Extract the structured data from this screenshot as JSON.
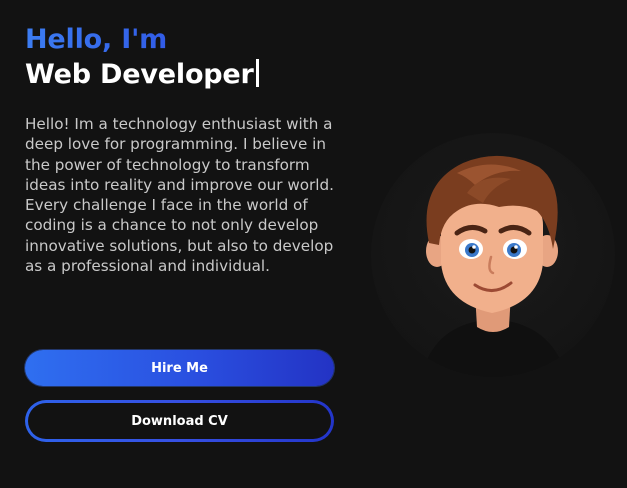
{
  "hero": {
    "greeting": "Hello, I'm",
    "role": "Web Developer",
    "bio": "Hello! Im a technology enthusiast with a deep love for programming. I believe in the power of technology to transform ideas into reality and improve our world. Every challenge I face in the world of coding is a chance to not only develop innovative solutions, but also to develop as a professional and individual."
  },
  "buttons": {
    "hire_label": "Hire Me",
    "cv_label": "Download CV"
  },
  "colors": {
    "accent_start": "#3c7df2",
    "accent_end": "#1f2cb8",
    "background": "#121212"
  },
  "icons": {
    "avatar": "cartoon-developer-avatar"
  }
}
